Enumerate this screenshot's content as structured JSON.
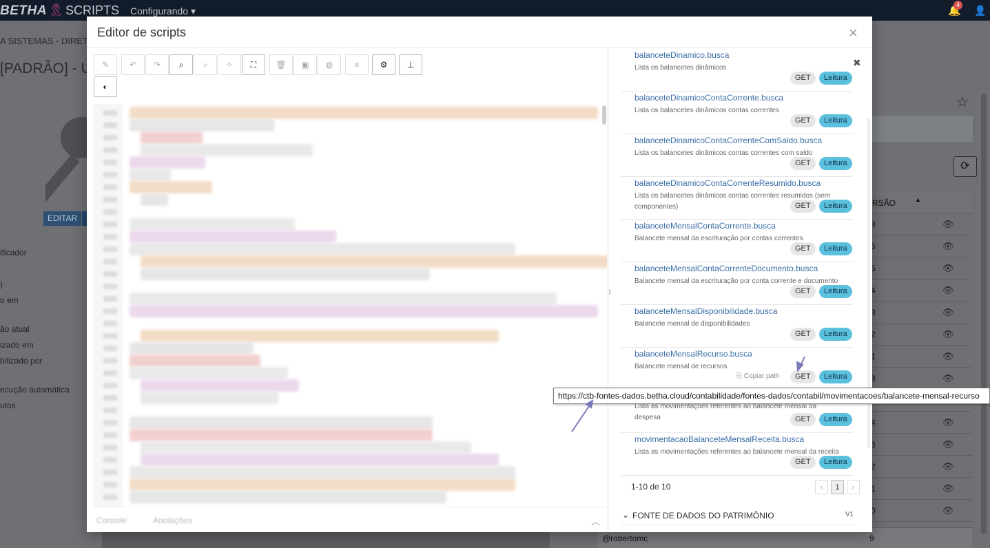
{
  "app": {
    "brand": "BETHA",
    "product": "SCRIPTS",
    "context_menu": "Configurando",
    "notification_count": "4"
  },
  "background": {
    "organization": "A SISTEMAS - DIRET",
    "page_title": "[PADRÃO] - Ut",
    "edit_button": "EDITAR",
    "labels": [
      "ificador",
      ")",
      "o em",
      "ão atual",
      "izado em",
      "bilizado por",
      "ecução automática",
      "utos"
    ],
    "table_header": "RSÃO",
    "versions": [
      "8",
      "6",
      "5",
      "4",
      "3",
      "2",
      "1",
      "8",
      "9",
      "4",
      "3",
      "2",
      "1",
      "0"
    ],
    "author": "@robertomc",
    "author_version": "9"
  },
  "modal": {
    "title": "Editor de scripts",
    "close": "×"
  },
  "editor": {
    "tabs": [
      "Console",
      "Anotações"
    ],
    "toolbar_icons": [
      "pencil-icon",
      "undo-icon",
      "redo-icon",
      "search-icon",
      "search-replace-icon",
      "magic-wand-icon",
      "fullscreen-icon",
      "trash-icon",
      "save-icon",
      "globe-icon",
      "format-icon",
      "gear-icon",
      "sitemap-icon",
      "contrast-icon"
    ]
  },
  "api_panel": {
    "copy_path_label": "Copiar path",
    "items": [
      {
        "name": "balanceteDinamico.busca",
        "description": "Lista os balancetes dinâmicos",
        "method": "GET",
        "access": "Leitura"
      },
      {
        "name": "balanceteDinamicoContaCorrente.busca",
        "description": "Lista os balancetes dinâmicos contas correntes",
        "method": "GET",
        "access": "Leitura"
      },
      {
        "name": "balanceteDinamicoContaCorrenteComSaldo.busca",
        "description": "Lista os balancetes dinâmicos contas correntes com saldo",
        "method": "GET",
        "access": "Leitura"
      },
      {
        "name": "balanceteDinamicoContaCorrenteResumido.busca",
        "description": "Lista os balancetes dinâmicos contas correntes resumidos (sem componentes)",
        "method": "GET",
        "access": "Leitura"
      },
      {
        "name": "balanceteMensalContaCorrente.busca",
        "description": "Balancete mensal da escrituração por contas correntes",
        "method": "GET",
        "access": "Leitura"
      },
      {
        "name": "balanceteMensalContaCorrenteDocumento.busca",
        "description": "Balancete mensal da escrituração por conta corrente e documento",
        "method": "GET",
        "access": "Leitura"
      },
      {
        "name": "balanceteMensalDisponibilidade.busca",
        "description": "Balancete mensal de disponibilidades",
        "method": "GET",
        "access": "Leitura"
      },
      {
        "name": "balanceteMensalRecurso.busca",
        "description": "Balancete mensal de recursos",
        "method": "GET",
        "access": "Leitura"
      },
      {
        "name": "",
        "description": "Lista as movimentações referentes ao balancete mensal da despesa",
        "method": "GET",
        "access": "Leitura"
      },
      {
        "name": "movimentacaoBalanceteMensalReceita.busca",
        "description": "Lista as movimentações referentes ao balancete mensal da receita",
        "method": "GET",
        "access": "Leitura"
      }
    ],
    "pager_info": "1-10 de 10",
    "pager_current": "1",
    "section_title": "FONTE DE DADOS DO PATRIMÔNIO",
    "section_version": "V1"
  },
  "tooltip": {
    "url": "https://ctb-fontes-dados.betha.cloud/contabilidade/fontes-dados/contabil/movimentacoes/balancete-mensal-recurso"
  },
  "colors": {
    "accent_link": "#3a6ea5",
    "badge_leitura": "#5bc0de",
    "badge_get": "#e6e6e6",
    "topbar": "#121c2b",
    "annotation_arrow": "#7b79b8"
  }
}
